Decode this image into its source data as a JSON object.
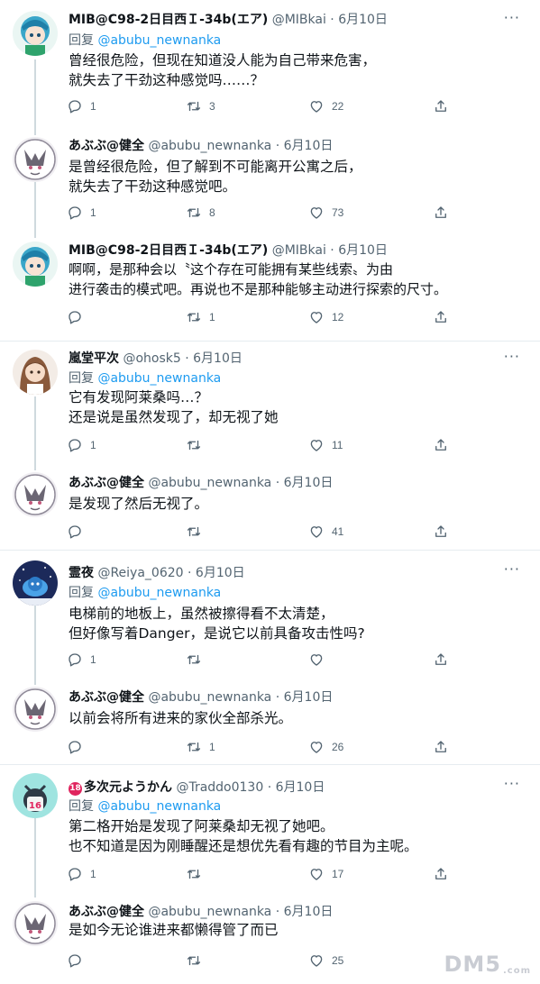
{
  "tweets": [
    {
      "name": "MIB@C98-2日目西Ｉ-34b(エア)",
      "handle": "@MIBkai",
      "dot": "·",
      "time": "6月10日",
      "reply_prefix": "回复",
      "reply_to": "@abubu_newnanka",
      "text": "曾经很危险，但现在知道没人能为自己带来危害，\n就失去了干劲这种感觉吗……？",
      "replies": "1",
      "retweets": "3",
      "likes": "22"
    },
    {
      "name": "あぶぶ@健全",
      "handle": "@abubu_newnanka",
      "dot": "·",
      "time": "6月10日",
      "text": "是曾经很危险，但了解到不可能离开公寓之后，\n就失去了干劲这种感觉吧。",
      "replies": "1",
      "retweets": "8",
      "likes": "73"
    },
    {
      "name": "MIB@C98-2日目西Ｉ-34b(エア)",
      "handle": "@MIBkai",
      "dot": "·",
      "time": "6月10日",
      "text": "啊啊，是那种会以〝这个存在可能拥有某些线索〟为由\n进行袭击的模式吧。再说也不是那种能够主动进行探索的尺寸。",
      "replies": "",
      "retweets": "1",
      "likes": "12"
    },
    {
      "name": "嵐堂平次",
      "handle": "@ohosk5",
      "dot": "·",
      "time": "6月10日",
      "reply_prefix": "回复",
      "reply_to": "@abubu_newnanka",
      "text": "它有发现阿莱桑吗…？\n还是说是虽然发现了，却无视了她",
      "replies": "1",
      "retweets": "",
      "likes": "11"
    },
    {
      "name": "あぶぶ@健全",
      "handle": "@abubu_newnanka",
      "dot": "·",
      "time": "6月10日",
      "text": "是发现了然后无视了。",
      "replies": "",
      "retweets": "",
      "likes": "41"
    },
    {
      "name": "霊夜",
      "handle": "@Reiya_0620",
      "dot": "·",
      "time": "6月10日",
      "reply_prefix": "回复",
      "reply_to": "@abubu_newnanka",
      "text": "电梯前的地板上，虽然被擦得看不太清楚，\n但好像写着Danger，是说它以前具备攻击性吗?",
      "replies": "1",
      "retweets": "",
      "likes": ""
    },
    {
      "name": "あぶぶ@健全",
      "handle": "@abubu_newnanka",
      "dot": "·",
      "time": "6月10日",
      "text": "以前会将所有进来的家伙全部杀光。",
      "replies": "",
      "retweets": "1",
      "likes": "26"
    },
    {
      "badge": "18",
      "name": "多次元ようかん",
      "handle": "@Traddo0130",
      "dot": "·",
      "time": "6月10日",
      "reply_prefix": "回复",
      "reply_to": "@abubu_newnanka",
      "text": "第二格开始是发现了阿莱桑却无视了她吧。\n也不知道是因为刚睡醒还是想优先看有趣的节目为主呢。",
      "replies": "1",
      "retweets": "",
      "likes": "17"
    },
    {
      "name": "あぶぶ@健全",
      "handle": "@abubu_newnanka",
      "dot": "·",
      "time": "6月10日",
      "text": "是如今无论谁进来都懒得管了而已",
      "replies": "",
      "retweets": "",
      "likes": "25"
    }
  ],
  "more_glyph": "···",
  "watermark": {
    "main": "DM5",
    "small": ".com"
  },
  "icons": {
    "reply": "reply-icon",
    "retweet": "retweet-icon",
    "like": "heart-icon",
    "share": "share-icon",
    "more": "more-icon"
  },
  "colors": {
    "text": "#0f1419",
    "secondary": "#536471",
    "link": "#1d9bf0",
    "divider": "#e6ecf0",
    "thread_line": "#cfd9de"
  }
}
